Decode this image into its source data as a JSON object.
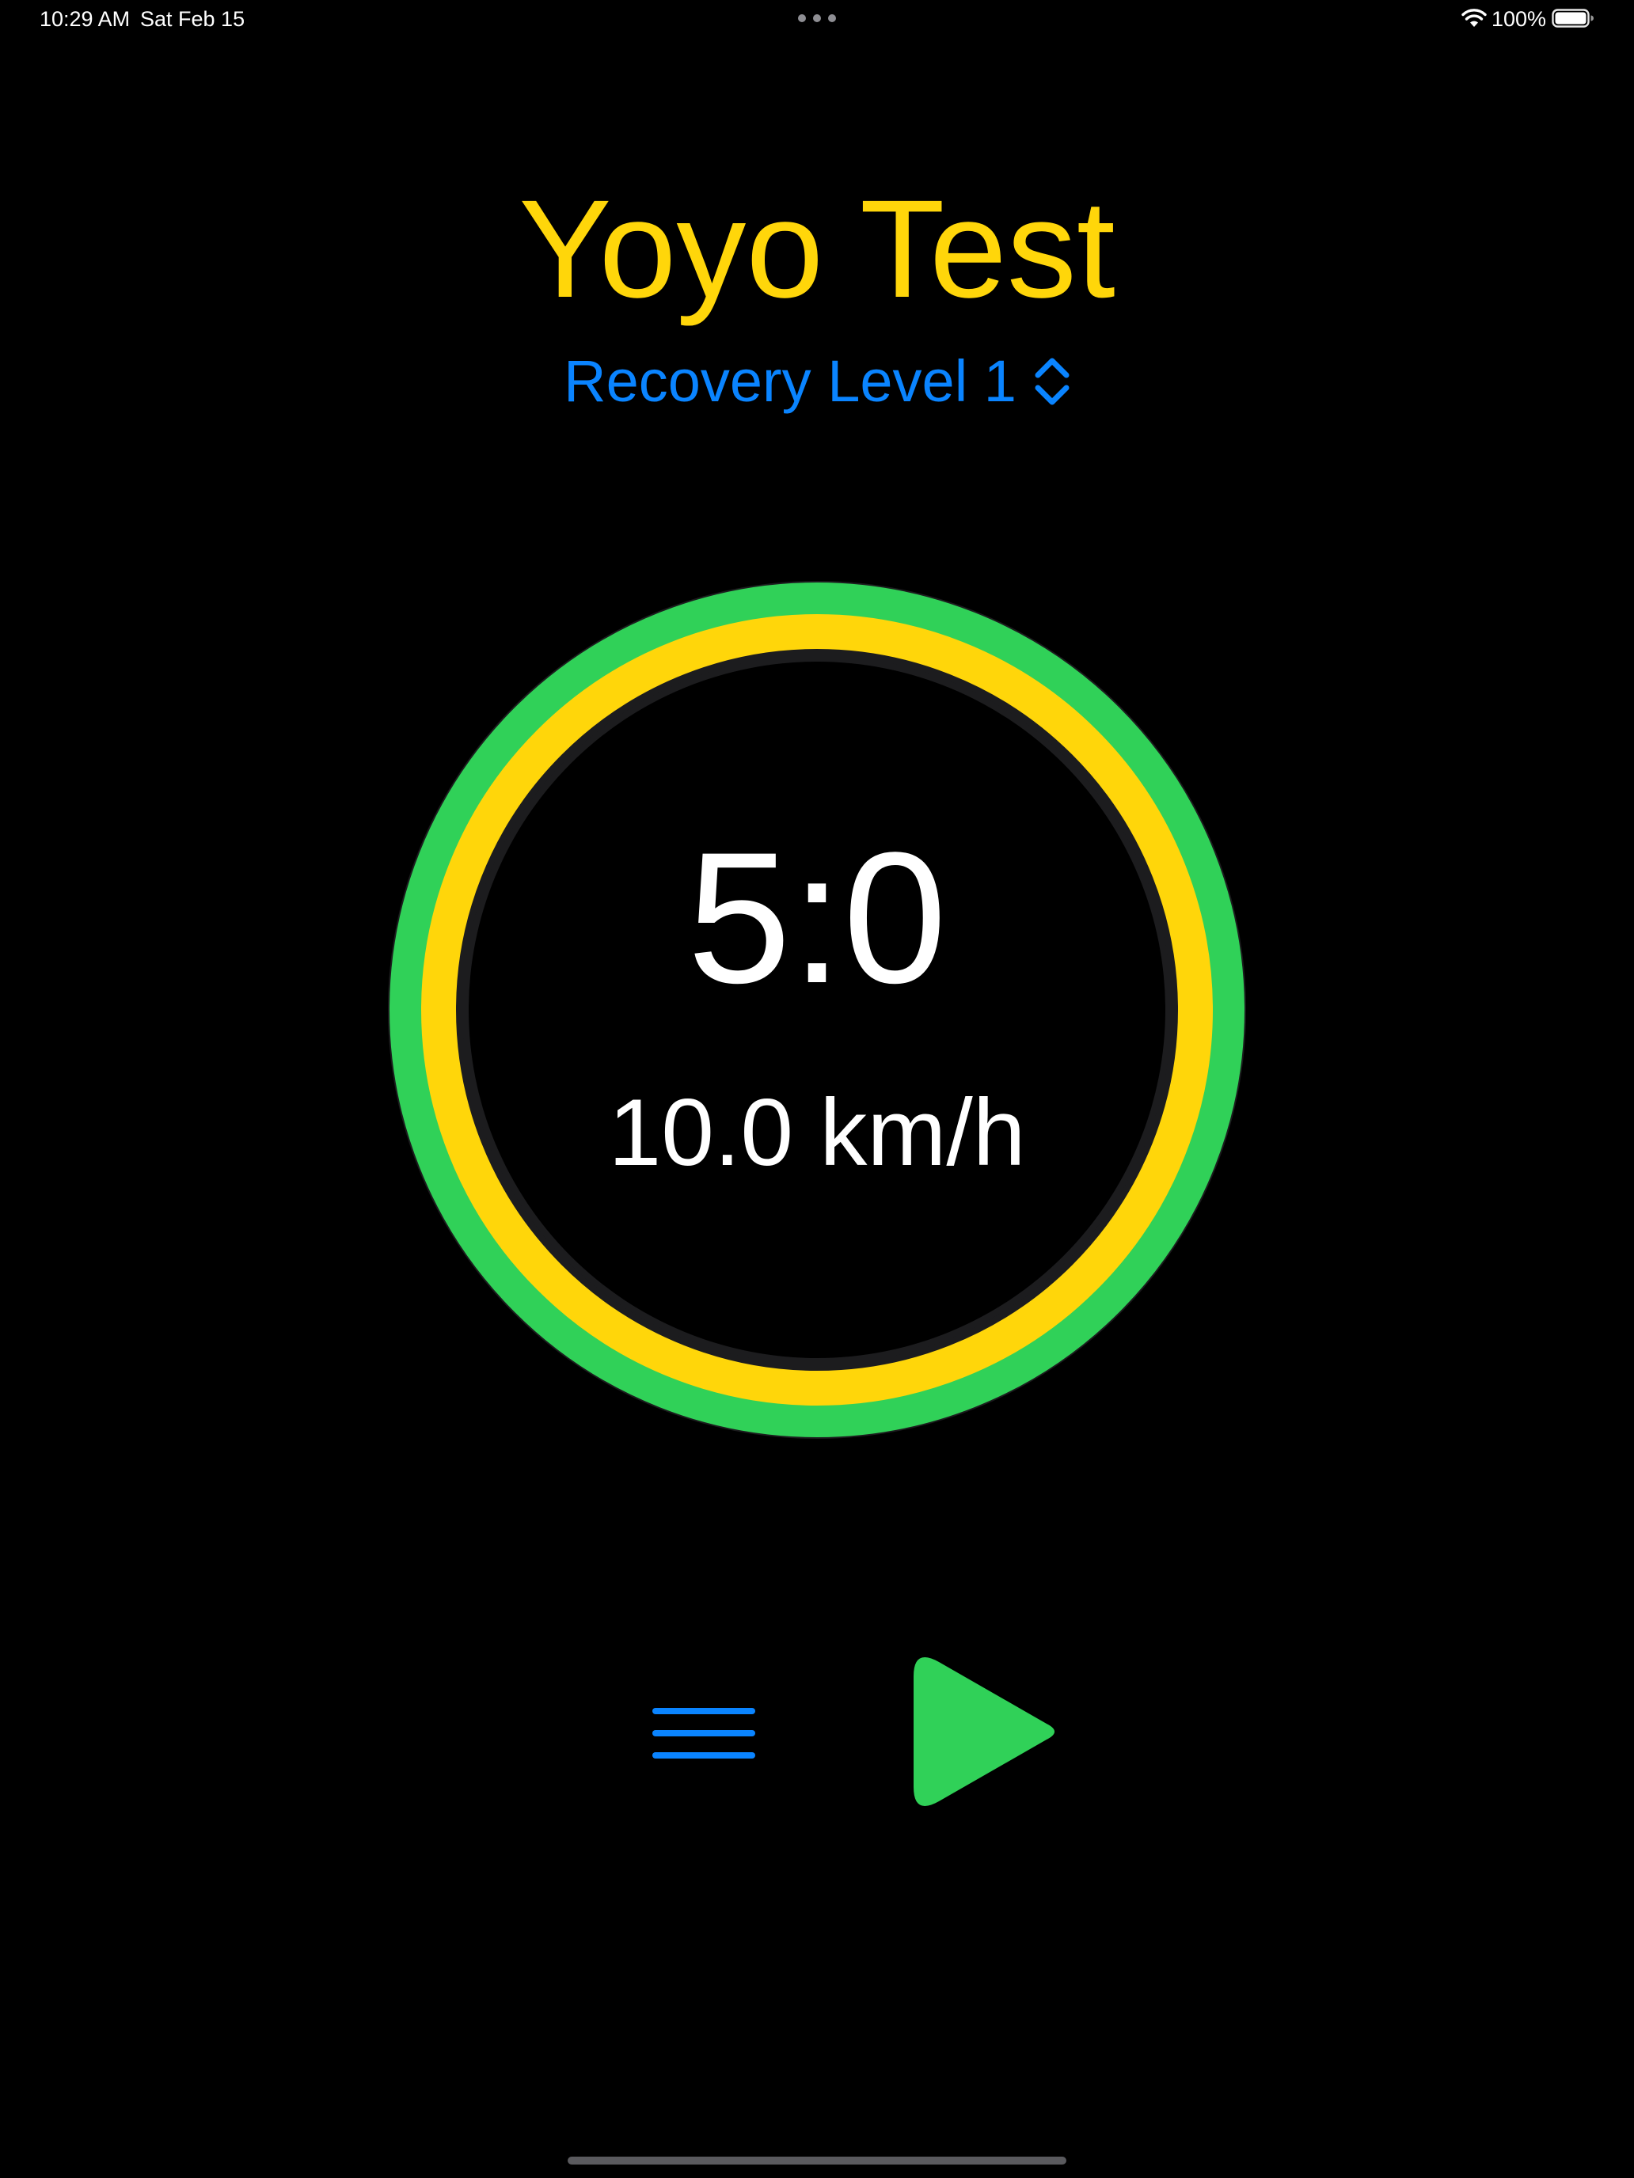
{
  "status_bar": {
    "time": "10:29 AM",
    "date": "Sat Feb 15",
    "battery_percent": "100%",
    "icons": [
      "wifi-icon",
      "battery-icon"
    ]
  },
  "app": {
    "title": "Yoyo Test"
  },
  "level_selector": {
    "label": "Recovery Level 1",
    "icon": "chevron-up-down-icon"
  },
  "timer": {
    "value": "5:0",
    "speed": "10.0 km/h"
  },
  "controls": {
    "menu_icon": "menu-icon",
    "play_icon": "play-icon"
  },
  "colors": {
    "background": "#000000",
    "title": "#ffd60a",
    "accent": "#0a84ff",
    "ring_outer": "#30d158",
    "ring_inner": "#ffd60a",
    "play": "#30d158",
    "text": "#ffffff"
  }
}
